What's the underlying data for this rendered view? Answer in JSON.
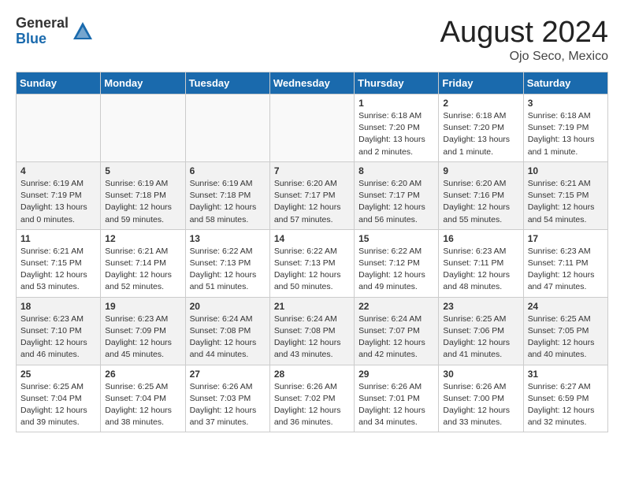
{
  "logo": {
    "general": "General",
    "blue": "Blue"
  },
  "title": {
    "month_year": "August 2024",
    "location": "Ojo Seco, Mexico"
  },
  "weekdays": [
    "Sunday",
    "Monday",
    "Tuesday",
    "Wednesday",
    "Thursday",
    "Friday",
    "Saturday"
  ],
  "weeks": [
    [
      {
        "day": "",
        "info": ""
      },
      {
        "day": "",
        "info": ""
      },
      {
        "day": "",
        "info": ""
      },
      {
        "day": "",
        "info": ""
      },
      {
        "day": "1",
        "info": "Sunrise: 6:18 AM\nSunset: 7:20 PM\nDaylight: 13 hours\nand 2 minutes."
      },
      {
        "day": "2",
        "info": "Sunrise: 6:18 AM\nSunset: 7:20 PM\nDaylight: 13 hours\nand 1 minute."
      },
      {
        "day": "3",
        "info": "Sunrise: 6:18 AM\nSunset: 7:19 PM\nDaylight: 13 hours\nand 1 minute."
      }
    ],
    [
      {
        "day": "4",
        "info": "Sunrise: 6:19 AM\nSunset: 7:19 PM\nDaylight: 13 hours\nand 0 minutes."
      },
      {
        "day": "5",
        "info": "Sunrise: 6:19 AM\nSunset: 7:18 PM\nDaylight: 12 hours\nand 59 minutes."
      },
      {
        "day": "6",
        "info": "Sunrise: 6:19 AM\nSunset: 7:18 PM\nDaylight: 12 hours\nand 58 minutes."
      },
      {
        "day": "7",
        "info": "Sunrise: 6:20 AM\nSunset: 7:17 PM\nDaylight: 12 hours\nand 57 minutes."
      },
      {
        "day": "8",
        "info": "Sunrise: 6:20 AM\nSunset: 7:17 PM\nDaylight: 12 hours\nand 56 minutes."
      },
      {
        "day": "9",
        "info": "Sunrise: 6:20 AM\nSunset: 7:16 PM\nDaylight: 12 hours\nand 55 minutes."
      },
      {
        "day": "10",
        "info": "Sunrise: 6:21 AM\nSunset: 7:15 PM\nDaylight: 12 hours\nand 54 minutes."
      }
    ],
    [
      {
        "day": "11",
        "info": "Sunrise: 6:21 AM\nSunset: 7:15 PM\nDaylight: 12 hours\nand 53 minutes."
      },
      {
        "day": "12",
        "info": "Sunrise: 6:21 AM\nSunset: 7:14 PM\nDaylight: 12 hours\nand 52 minutes."
      },
      {
        "day": "13",
        "info": "Sunrise: 6:22 AM\nSunset: 7:13 PM\nDaylight: 12 hours\nand 51 minutes."
      },
      {
        "day": "14",
        "info": "Sunrise: 6:22 AM\nSunset: 7:13 PM\nDaylight: 12 hours\nand 50 minutes."
      },
      {
        "day": "15",
        "info": "Sunrise: 6:22 AM\nSunset: 7:12 PM\nDaylight: 12 hours\nand 49 minutes."
      },
      {
        "day": "16",
        "info": "Sunrise: 6:23 AM\nSunset: 7:11 PM\nDaylight: 12 hours\nand 48 minutes."
      },
      {
        "day": "17",
        "info": "Sunrise: 6:23 AM\nSunset: 7:11 PM\nDaylight: 12 hours\nand 47 minutes."
      }
    ],
    [
      {
        "day": "18",
        "info": "Sunrise: 6:23 AM\nSunset: 7:10 PM\nDaylight: 12 hours\nand 46 minutes."
      },
      {
        "day": "19",
        "info": "Sunrise: 6:23 AM\nSunset: 7:09 PM\nDaylight: 12 hours\nand 45 minutes."
      },
      {
        "day": "20",
        "info": "Sunrise: 6:24 AM\nSunset: 7:08 PM\nDaylight: 12 hours\nand 44 minutes."
      },
      {
        "day": "21",
        "info": "Sunrise: 6:24 AM\nSunset: 7:08 PM\nDaylight: 12 hours\nand 43 minutes."
      },
      {
        "day": "22",
        "info": "Sunrise: 6:24 AM\nSunset: 7:07 PM\nDaylight: 12 hours\nand 42 minutes."
      },
      {
        "day": "23",
        "info": "Sunrise: 6:25 AM\nSunset: 7:06 PM\nDaylight: 12 hours\nand 41 minutes."
      },
      {
        "day": "24",
        "info": "Sunrise: 6:25 AM\nSunset: 7:05 PM\nDaylight: 12 hours\nand 40 minutes."
      }
    ],
    [
      {
        "day": "25",
        "info": "Sunrise: 6:25 AM\nSunset: 7:04 PM\nDaylight: 12 hours\nand 39 minutes."
      },
      {
        "day": "26",
        "info": "Sunrise: 6:25 AM\nSunset: 7:04 PM\nDaylight: 12 hours\nand 38 minutes."
      },
      {
        "day": "27",
        "info": "Sunrise: 6:26 AM\nSunset: 7:03 PM\nDaylight: 12 hours\nand 37 minutes."
      },
      {
        "day": "28",
        "info": "Sunrise: 6:26 AM\nSunset: 7:02 PM\nDaylight: 12 hours\nand 36 minutes."
      },
      {
        "day": "29",
        "info": "Sunrise: 6:26 AM\nSunset: 7:01 PM\nDaylight: 12 hours\nand 34 minutes."
      },
      {
        "day": "30",
        "info": "Sunrise: 6:26 AM\nSunset: 7:00 PM\nDaylight: 12 hours\nand 33 minutes."
      },
      {
        "day": "31",
        "info": "Sunrise: 6:27 AM\nSunset: 6:59 PM\nDaylight: 12 hours\nand 32 minutes."
      }
    ]
  ]
}
